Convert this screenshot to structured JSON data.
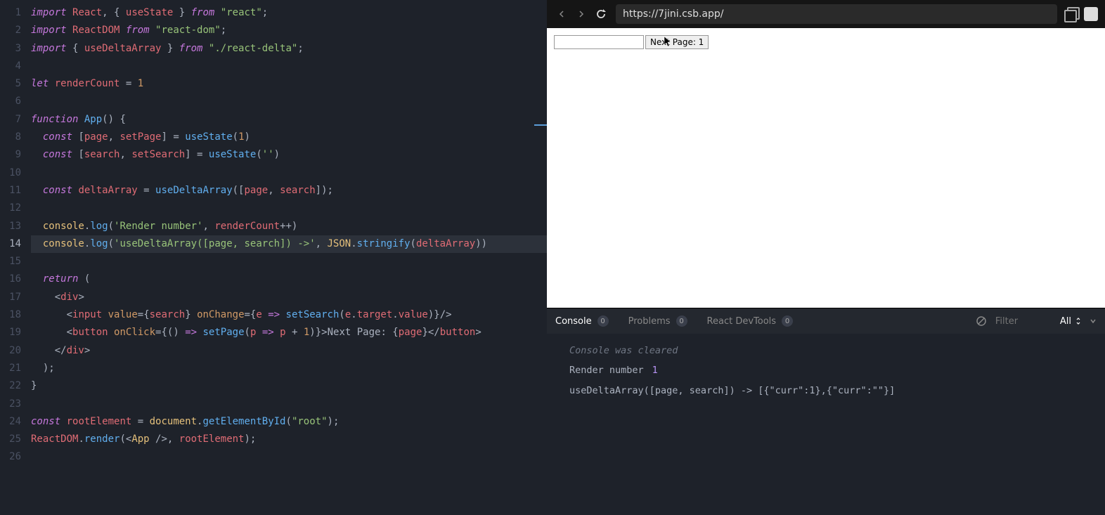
{
  "editor": {
    "line_count": 26,
    "active_line": 14,
    "code_lines": [
      [
        [
          "c-keyword",
          "import"
        ],
        [
          "c-punct",
          " "
        ],
        [
          "c-default",
          "React"
        ],
        [
          "c-punct",
          ", { "
        ],
        [
          "c-default",
          "useState"
        ],
        [
          "c-punct",
          " } "
        ],
        [
          "c-from",
          "from"
        ],
        [
          "c-punct",
          " "
        ],
        [
          "c-string",
          "\"react\""
        ],
        [
          "c-punct",
          ";"
        ]
      ],
      [
        [
          "c-keyword",
          "import"
        ],
        [
          "c-punct",
          " "
        ],
        [
          "c-default",
          "ReactDOM"
        ],
        [
          "c-punct",
          " "
        ],
        [
          "c-from",
          "from"
        ],
        [
          "c-punct",
          " "
        ],
        [
          "c-string",
          "\"react-dom\""
        ],
        [
          "c-punct",
          ";"
        ]
      ],
      [
        [
          "c-keyword",
          "import"
        ],
        [
          "c-punct",
          " { "
        ],
        [
          "c-default",
          "useDeltaArray"
        ],
        [
          "c-punct",
          " } "
        ],
        [
          "c-from",
          "from"
        ],
        [
          "c-punct",
          " "
        ],
        [
          "c-string",
          "\"./react-delta\""
        ],
        [
          "c-punct",
          ";"
        ]
      ],
      [],
      [
        [
          "c-keyword",
          "let"
        ],
        [
          "c-punct",
          " "
        ],
        [
          "c-default",
          "renderCount"
        ],
        [
          "c-punct",
          " = "
        ],
        [
          "c-number",
          "1"
        ]
      ],
      [],
      [
        [
          "c-keyword",
          "function"
        ],
        [
          "c-punct",
          " "
        ],
        [
          "c-func",
          "App"
        ],
        [
          "c-punct",
          "() {"
        ]
      ],
      [
        [
          "c-punct",
          "  "
        ],
        [
          "c-keyword",
          "const"
        ],
        [
          "c-punct",
          " ["
        ],
        [
          "c-default",
          "page"
        ],
        [
          "c-punct",
          ", "
        ],
        [
          "c-default",
          "setPage"
        ],
        [
          "c-punct",
          "] = "
        ],
        [
          "c-func",
          "useState"
        ],
        [
          "c-punct",
          "("
        ],
        [
          "c-number",
          "1"
        ],
        [
          "c-punct",
          ")"
        ]
      ],
      [
        [
          "c-punct",
          "  "
        ],
        [
          "c-keyword",
          "const"
        ],
        [
          "c-punct",
          " ["
        ],
        [
          "c-default",
          "search"
        ],
        [
          "c-punct",
          ", "
        ],
        [
          "c-default",
          "setSearch"
        ],
        [
          "c-punct",
          "] = "
        ],
        [
          "c-func",
          "useState"
        ],
        [
          "c-punct",
          "("
        ],
        [
          "c-string",
          "''"
        ],
        [
          "c-punct",
          ")"
        ]
      ],
      [],
      [
        [
          "c-punct",
          "  "
        ],
        [
          "c-keyword",
          "const"
        ],
        [
          "c-punct",
          " "
        ],
        [
          "c-default",
          "deltaArray"
        ],
        [
          "c-punct",
          " = "
        ],
        [
          "c-func",
          "useDeltaArray"
        ],
        [
          "c-punct",
          "(["
        ],
        [
          "c-default",
          "page"
        ],
        [
          "c-punct",
          ", "
        ],
        [
          "c-default",
          "search"
        ],
        [
          "c-punct",
          "]);"
        ]
      ],
      [],
      [
        [
          "c-punct",
          "  "
        ],
        [
          "c-this",
          "console"
        ],
        [
          "c-punct",
          "."
        ],
        [
          "c-method",
          "log"
        ],
        [
          "c-punct",
          "("
        ],
        [
          "c-string",
          "'Render number'"
        ],
        [
          "c-punct",
          ", "
        ],
        [
          "c-default",
          "renderCount"
        ],
        [
          "c-punct",
          "++)"
        ]
      ],
      [
        [
          "c-punct",
          "  "
        ],
        [
          "c-this",
          "console"
        ],
        [
          "c-punct",
          "."
        ],
        [
          "c-method",
          "log"
        ],
        [
          "c-punct",
          "("
        ],
        [
          "c-string",
          "'useDeltaArray([page, search]) ->'"
        ],
        [
          "c-punct",
          ", "
        ],
        [
          "c-variable",
          "JSON"
        ],
        [
          "c-punct",
          "."
        ],
        [
          "c-method",
          "stringify"
        ],
        [
          "c-punct",
          "("
        ],
        [
          "c-default",
          "deltaArray"
        ],
        [
          "c-punct",
          "))"
        ]
      ],
      [],
      [
        [
          "c-punct",
          "  "
        ],
        [
          "c-keyword",
          "return"
        ],
        [
          "c-punct",
          " ("
        ]
      ],
      [
        [
          "c-punct",
          "    <"
        ],
        [
          "c-tag",
          "div"
        ],
        [
          "c-punct",
          ">"
        ]
      ],
      [
        [
          "c-punct",
          "      <"
        ],
        [
          "c-tag",
          "input"
        ],
        [
          "c-punct",
          " "
        ],
        [
          "c-attr",
          "value"
        ],
        [
          "c-punct",
          "={"
        ],
        [
          "c-default",
          "search"
        ],
        [
          "c-punct",
          "} "
        ],
        [
          "c-attr",
          "onChange"
        ],
        [
          "c-punct",
          "={"
        ],
        [
          "c-param",
          "e"
        ],
        [
          "c-punct",
          " "
        ],
        [
          "c-keyword",
          "=>"
        ],
        [
          "c-punct",
          " "
        ],
        [
          "c-func",
          "setSearch"
        ],
        [
          "c-punct",
          "("
        ],
        [
          "c-param",
          "e"
        ],
        [
          "c-punct",
          "."
        ],
        [
          "c-prop",
          "target"
        ],
        [
          "c-punct",
          "."
        ],
        [
          "c-prop",
          "value"
        ],
        [
          "c-punct",
          ")}/>"
        ]
      ],
      [
        [
          "c-punct",
          "      <"
        ],
        [
          "c-tag",
          "button"
        ],
        [
          "c-punct",
          " "
        ],
        [
          "c-attr",
          "onClick"
        ],
        [
          "c-punct",
          "={() "
        ],
        [
          "c-keyword",
          "=>"
        ],
        [
          "c-punct",
          " "
        ],
        [
          "c-func",
          "setPage"
        ],
        [
          "c-punct",
          "("
        ],
        [
          "c-param",
          "p"
        ],
        [
          "c-punct",
          " "
        ],
        [
          "c-keyword",
          "=>"
        ],
        [
          "c-punct",
          " "
        ],
        [
          "c-param",
          "p"
        ],
        [
          "c-punct",
          " + "
        ],
        [
          "c-number",
          "1"
        ],
        [
          "c-punct",
          ")}>Next Page: {"
        ],
        [
          "c-default",
          "page"
        ],
        [
          "c-punct",
          "}</"
        ],
        [
          "c-tag",
          "button"
        ],
        [
          "c-punct",
          ">"
        ]
      ],
      [
        [
          "c-punct",
          "    </"
        ],
        [
          "c-tag",
          "div"
        ],
        [
          "c-punct",
          ">"
        ]
      ],
      [
        [
          "c-punct",
          "  );"
        ]
      ],
      [
        [
          "c-punct",
          "}"
        ]
      ],
      [],
      [
        [
          "c-keyword",
          "const"
        ],
        [
          "c-punct",
          " "
        ],
        [
          "c-default",
          "rootElement"
        ],
        [
          "c-punct",
          " = "
        ],
        [
          "c-variable",
          "document"
        ],
        [
          "c-punct",
          "."
        ],
        [
          "c-method",
          "getElementById"
        ],
        [
          "c-punct",
          "("
        ],
        [
          "c-string",
          "\"root\""
        ],
        [
          "c-punct",
          ");"
        ]
      ],
      [
        [
          "c-default",
          "ReactDOM"
        ],
        [
          "c-punct",
          "."
        ],
        [
          "c-method",
          "render"
        ],
        [
          "c-punct",
          "(<"
        ],
        [
          "c-variable",
          "App"
        ],
        [
          "c-punct",
          " />, "
        ],
        [
          "c-default",
          "rootElement"
        ],
        [
          "c-punct",
          ");"
        ]
      ],
      []
    ]
  },
  "browser": {
    "url": "https://7jini.csb.app/"
  },
  "preview": {
    "input_value": "",
    "button_label": "Next Page: 1"
  },
  "console": {
    "tabs": [
      {
        "label": "Console",
        "count": "0",
        "active": true
      },
      {
        "label": "Problems",
        "count": "0",
        "active": false
      },
      {
        "label": "React DevTools",
        "count": "0",
        "active": false
      }
    ],
    "filter_placeholder": "Filter",
    "level": "All",
    "cleared_text": "Console was cleared",
    "messages": [
      {
        "text": "Render number",
        "value": "1"
      },
      {
        "text": "useDeltaArray([page, search]) ->  [{\"curr\":1},{\"curr\":\"\"}]"
      }
    ]
  }
}
